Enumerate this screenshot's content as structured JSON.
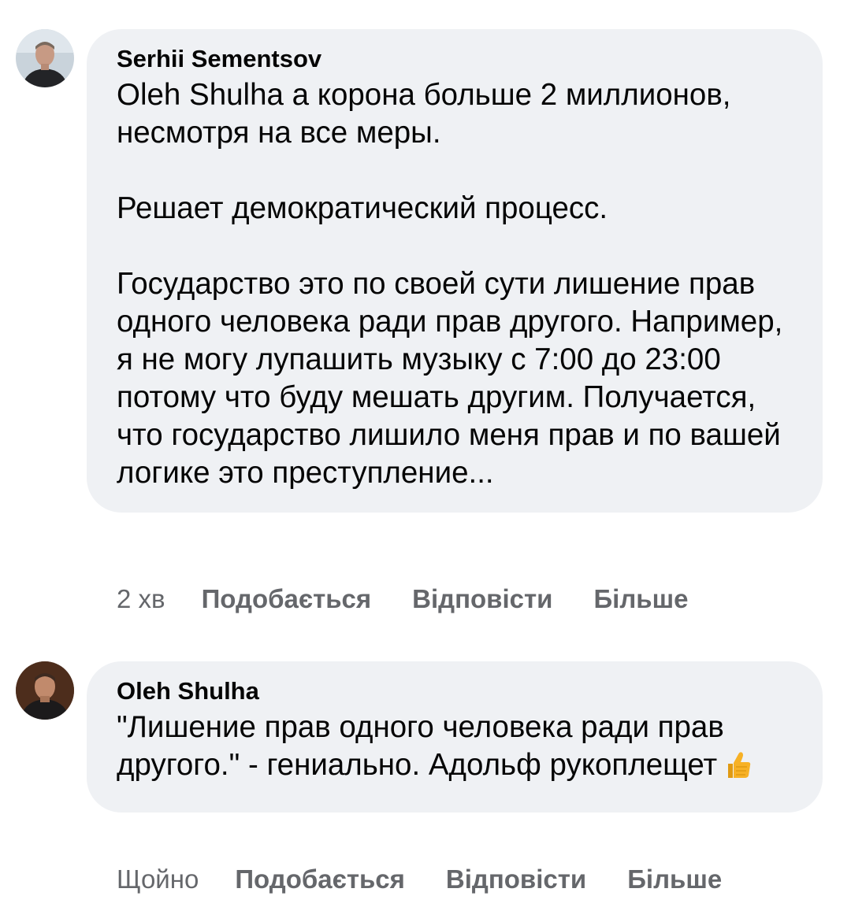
{
  "comments": [
    {
      "author": "Serhii Sementsov",
      "text": "Oleh Shulha а корона больше 2 миллионов, несмотря на все меры.\n\nРешает демократический процесс.\n\nГосударство это по своей сути лишение прав одного человека ради прав другого. Например, я не могу лупашить музыку с 7:00 до 23:00 потому что буду мешать другим. Получается, что государство лишило меня прав и по вашей логике это преступление...",
      "time": "2 хв",
      "like_label": "Подобається",
      "reply_label": "Відповісти",
      "more_label": "Більше"
    },
    {
      "author": "Oleh Shulha",
      "text": "\"Лишение прав одного человека ради прав другого.\" - гениально. Адольф рукоплещет",
      "emoji": "thumbs-up-icon",
      "time": "Щойно",
      "like_label": "Подобається",
      "reply_label": "Відповісти",
      "more_label": "Більше"
    }
  ],
  "colors": {
    "bubble": "#eff1f4",
    "secondary_text": "#65676b",
    "emoji": "#f7b125"
  }
}
